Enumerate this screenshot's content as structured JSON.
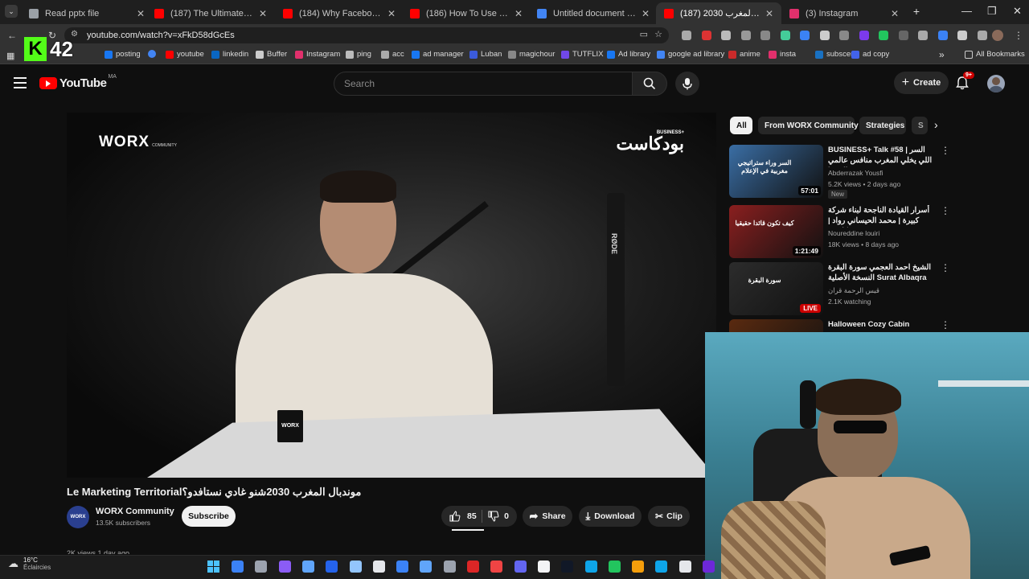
{
  "browser": {
    "tabs": [
      {
        "title": "Read pptx file",
        "color": "#9aa0a6",
        "active": false
      },
      {
        "title": "(187) The Ultimate Digital Ma",
        "color": "#ff0000",
        "active": false
      },
      {
        "title": "(184) Why Facebook Ads Are",
        "color": "#ff0000",
        "active": false
      },
      {
        "title": "(186) How To Use TikTok LIVE",
        "color": "#ff0000",
        "active": false
      },
      {
        "title": "Untitled document - Google",
        "color": "#4285f4",
        "active": false
      },
      {
        "title": "(187) موندبال المغرب 2030",
        "color": "#ff0000",
        "active": true
      },
      {
        "title": "(3) Instagram",
        "color": "#e1306c",
        "active": false
      }
    ],
    "new_tab_glyph": "+",
    "close_glyph": "✕",
    "url": "youtube.com/watch?v=xFkD58dGcEs",
    "bookmarks": [
      {
        "label": "posting",
        "color": "#1877f2"
      },
      {
        "label": "",
        "color": "#4285f4"
      },
      {
        "label": "youtube",
        "color": "#ff0000"
      },
      {
        "label": "linkedin",
        "color": "#0a66c2"
      },
      {
        "label": "Buffer",
        "color": "#cccccc"
      },
      {
        "label": "Instagram",
        "color": "#e1306c"
      },
      {
        "label": "ping",
        "color": "#bbbbbb"
      },
      {
        "label": "acc",
        "color": "#aaaaaa"
      },
      {
        "label": "ad manager",
        "color": "#1877f2"
      },
      {
        "label": "Luban",
        "color": "#3b5bdb"
      },
      {
        "label": "magichour",
        "color": "#888888"
      },
      {
        "label": "TUTFLIX",
        "color": "#7048e8"
      },
      {
        "label": "Ad library",
        "color": "#1877f2"
      },
      {
        "label": "google ad library",
        "color": "#4285f4"
      },
      {
        "label": "anime",
        "color": "#c92a2a"
      },
      {
        "label": "insta",
        "color": "#e1306c"
      },
      {
        "label": "subscene",
        "color": "#1971c2"
      },
      {
        "label": "ad copy",
        "color": "#4263eb"
      }
    ],
    "all_bookmarks": "All Bookmarks"
  },
  "overlay": {
    "k_letter": "K",
    "number": "42"
  },
  "youtube": {
    "logo_text": "YouTube",
    "region": "MA",
    "search_placeholder": "Search",
    "create_label": "Create",
    "notifications": "9+",
    "video": {
      "title": "Le Marketing Territorialموندبال المغرب 2030شنو غادي نستافدو؟",
      "brand_left": "WORX",
      "brand_left_sub": "COMMUNITY",
      "brand_right": "بودكاست",
      "brand_right_sup": "BUSINESS+",
      "mug_text": "WORX",
      "mic_text": "RØDE"
    },
    "channel": {
      "name": "WORX Community",
      "subscribers": "13.5K subscribers",
      "avatar_text": "WORX"
    },
    "actions": {
      "subscribe": "Subscribe",
      "likes": "85",
      "dislikes": "0",
      "share": "Share",
      "download": "Download",
      "clip": "Clip"
    },
    "views_partial": "2K views  1 day ago",
    "chips": [
      "All",
      "From WORX Community",
      "Strategies",
      "S"
    ],
    "recommendations": [
      {
        "title": "BUSINESS+ Talk #58 | السر اللي يخلي المغرب منافس عالمي فالميديا",
        "channel": "Abderrazak Yousfi",
        "stats": "5.2K views • 2 days ago",
        "badge": "New",
        "duration": "57:01",
        "thumb_text": "السر وراء ستراتيجي مغربية في الإعلام",
        "thumb_bg": "#3a6ea5"
      },
      {
        "title": "أسرار القيادة الناجحة لبناء شركة كبيرة | محمد الحيساني رواد | بودكاست",
        "channel": "Noureddine louiri",
        "stats": "18K views • 8 days ago",
        "badge": "",
        "duration": "1:21:49",
        "thumb_text": "كيف تكون قائدا حقيقيا",
        "thumb_bg": "#8a1f1f"
      },
      {
        "title": "الشيخ احمد العجمي سورة البقرة النسخة الأصلية Surat Albaqra Official ...",
        "channel": "قيس الرحمة قران",
        "stats": "2.1K watching",
        "badge": "",
        "duration": "LIVE",
        "thumb_text": "سورة البقرة",
        "thumb_bg": "#2c2c2c"
      },
      {
        "title": "Halloween Cozy Cabin",
        "channel": "",
        "stats": "",
        "badge": "",
        "duration": "",
        "thumb_text": "",
        "thumb_bg": "#5a2a10"
      }
    ]
  },
  "taskbar": {
    "weather_temp": "16°C",
    "weather_desc": "Éclaircies",
    "apps": [
      "#3b82f6",
      "#9ca3af",
      "#8b5cf6",
      "#60a5fa",
      "#2563eb",
      "#93c5fd",
      "#e5e7eb",
      "#3b82f6",
      "#60a5fa",
      "#9ca3af",
      "#dc2626",
      "#ef4444",
      "#6366f1",
      "#f3f4f6",
      "#111827",
      "#0ea5e9",
      "#22c55e",
      "#f59e0b",
      "#0ea5e9",
      "#e5e7eb",
      "#6d28d9"
    ]
  }
}
